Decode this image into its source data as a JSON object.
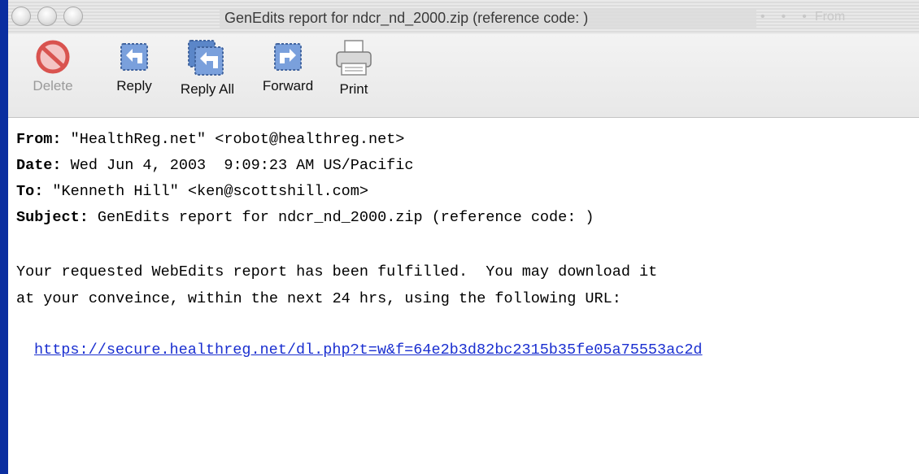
{
  "window": {
    "title": "GenEdits report for ndcr_nd_2000.zip (reference code: )",
    "ghost_column": "From"
  },
  "toolbar": {
    "delete_label": "Delete",
    "reply_label": "Reply",
    "reply_all_label": "Reply All",
    "forward_label": "Forward",
    "print_label": "Print"
  },
  "headers": {
    "from_label": "From:",
    "from_value": " \"HealthReg.net\" <robot@healthreg.net>",
    "date_label": "Date:",
    "date_value": " Wed Jun 4, 2003  9:09:23 AM US/Pacific",
    "to_label": "To:",
    "to_value": " \"Kenneth Hill\" <ken@scottshill.com>",
    "subject_label": "Subject:",
    "subject_value": " GenEdits report for ndcr_nd_2000.zip (reference code: )"
  },
  "message": {
    "line1": "Your requested WebEdits report has been fulfilled.  You may download it",
    "line2": "at your conveince, within the next 24 hrs, using the following URL:",
    "url": "https://secure.healthreg.net/dl.php?t=w&f=64e2b3d82bc2315b35fe05a75553ac2d"
  },
  "icons": {
    "delete": "delete-icon",
    "reply": "reply-icon",
    "reply_all": "reply-all-icon",
    "forward": "forward-icon",
    "print": "print-icon"
  },
  "colors": {
    "background_blue": "#0a2ea0",
    "link": "#1a2fd0",
    "icon_blue": "#5b86c8",
    "delete_red": "#d9534f"
  }
}
